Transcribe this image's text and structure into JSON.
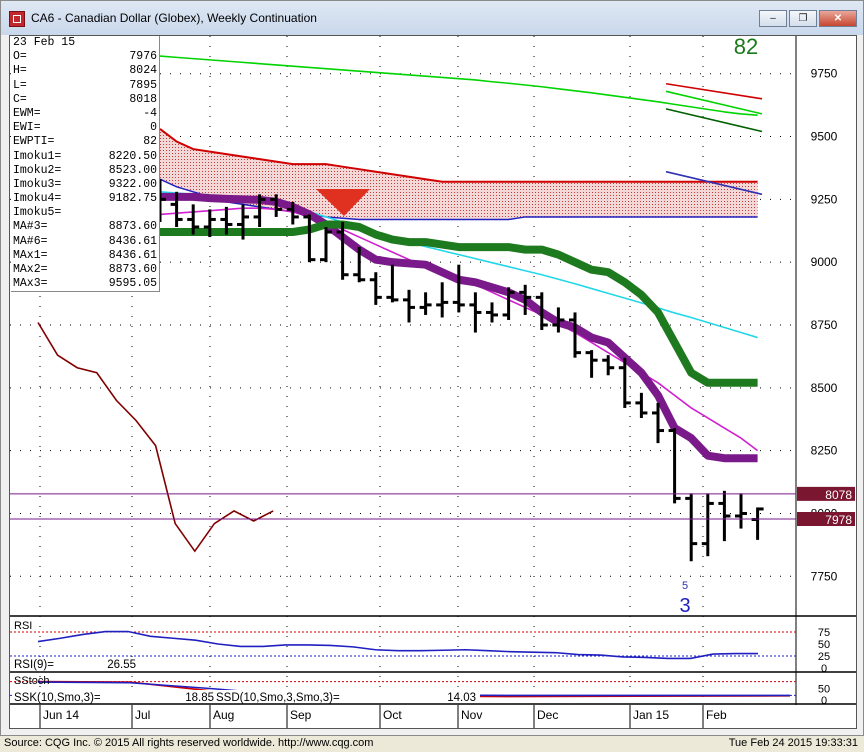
{
  "window": {
    "title": "CA6 - Canadian Dollar (Globex), Weekly Continuation",
    "buttons": {
      "minimize": "–",
      "restore": "❐",
      "close": "✕"
    }
  },
  "info_panel": {
    "date": "23 Feb 15",
    "rows": [
      {
        "label": "O=",
        "value": "7976"
      },
      {
        "label": "H=",
        "value": "8024"
      },
      {
        "label": "L=",
        "value": "7895"
      },
      {
        "label": "C=",
        "value": "8018"
      },
      {
        "label": "EWM=",
        "value": "-4"
      },
      {
        "label": "EWI=",
        "value": "0"
      },
      {
        "label": "EWPTI=",
        "value": "82"
      },
      {
        "label": "Imoku1=",
        "value": "8220.50"
      },
      {
        "label": "Imoku2=",
        "value": "8523.00"
      },
      {
        "label": "Imoku3=",
        "value": "9322.00"
      },
      {
        "label": "Imoku4=",
        "value": "9182.75"
      },
      {
        "label": "Imoku5=",
        "value": ""
      },
      {
        "label": "MA#3=",
        "value": "8873.60"
      },
      {
        "label": "MA#6=",
        "value": "8436.61"
      },
      {
        "label": "MAx1=",
        "value": "8436.61"
      },
      {
        "label": "MAx2=",
        "value": "8873.60"
      },
      {
        "label": "MAx3=",
        "value": "9595.05"
      }
    ]
  },
  "panels": {
    "rsi": {
      "title": "RSI",
      "readout_label": "RSI(9)=",
      "readout_value": "26.55",
      "ticks": [
        "75",
        "50",
        "25",
        "0"
      ]
    },
    "stoch": {
      "title": "SStoch",
      "ssk_label": "SSK(10,Smo,3)=",
      "ssk_value": "18.85",
      "ssd_label": "SSD(10,Smo,3,Smo,3)=",
      "ssd_value": "14.03",
      "ticks": [
        "50",
        "0"
      ]
    }
  },
  "chart_data": {
    "type": "bar",
    "subtype": "ohlc",
    "title": "CA6 - Canadian Dollar (Globex), Weekly Continuation",
    "ylim": [
      7600,
      9900
    ],
    "y_ticks": [
      9750,
      9500,
      9250,
      9000,
      8750,
      8500,
      8250,
      8000,
      7750
    ],
    "x_ticks": [
      "Jun 14",
      "Jul",
      "Aug",
      "Sep",
      "Oct",
      "Nov",
      "Dec",
      "Jan 15",
      "Feb"
    ],
    "grid": true,
    "ewpti_value": "82",
    "wave_labels": [
      "5",
      "3"
    ],
    "price_tags": [
      {
        "label": "8078",
        "value": 8078,
        "color": "#7a1630"
      },
      {
        "label": "7978",
        "value": 7978,
        "color": "#7a1630"
      }
    ],
    "bars": [
      {
        "o": 9270,
        "h": 9330,
        "l": 9160,
        "c": 9250
      },
      {
        "o": 9230,
        "h": 9280,
        "l": 9140,
        "c": 9170
      },
      {
        "o": 9170,
        "h": 9230,
        "l": 9110,
        "c": 9140
      },
      {
        "o": 9140,
        "h": 9210,
        "l": 9100,
        "c": 9170
      },
      {
        "o": 9170,
        "h": 9220,
        "l": 9110,
        "c": 9150
      },
      {
        "o": 9150,
        "h": 9230,
        "l": 9090,
        "c": 9180
      },
      {
        "o": 9180,
        "h": 9270,
        "l": 9140,
        "c": 9250
      },
      {
        "o": 9250,
        "h": 9270,
        "l": 9180,
        "c": 9210
      },
      {
        "o": 9210,
        "h": 9240,
        "l": 9150,
        "c": 9180
      },
      {
        "o": 9180,
        "h": 9190,
        "l": 9000,
        "c": 9010
      },
      {
        "o": 9010,
        "h": 9140,
        "l": 9000,
        "c": 9120
      },
      {
        "o": 9120,
        "h": 9160,
        "l": 8930,
        "c": 8950
      },
      {
        "o": 8950,
        "h": 9060,
        "l": 8920,
        "c": 8930
      },
      {
        "o": 8930,
        "h": 8960,
        "l": 8830,
        "c": 8860
      },
      {
        "o": 8860,
        "h": 8990,
        "l": 8840,
        "c": 8850
      },
      {
        "o": 8850,
        "h": 8890,
        "l": 8760,
        "c": 8820
      },
      {
        "o": 8820,
        "h": 8880,
        "l": 8790,
        "c": 8830
      },
      {
        "o": 8830,
        "h": 8920,
        "l": 8780,
        "c": 8840
      },
      {
        "o": 8840,
        "h": 8990,
        "l": 8800,
        "c": 8830
      },
      {
        "o": 8830,
        "h": 8880,
        "l": 8720,
        "c": 8800
      },
      {
        "o": 8800,
        "h": 8840,
        "l": 8760,
        "c": 8790
      },
      {
        "o": 8790,
        "h": 8900,
        "l": 8770,
        "c": 8880
      },
      {
        "o": 8880,
        "h": 8910,
        "l": 8790,
        "c": 8860
      },
      {
        "o": 8860,
        "h": 8880,
        "l": 8730,
        "c": 8750
      },
      {
        "o": 8750,
        "h": 8820,
        "l": 8720,
        "c": 8770
      },
      {
        "o": 8770,
        "h": 8800,
        "l": 8620,
        "c": 8640
      },
      {
        "o": 8640,
        "h": 8650,
        "l": 8540,
        "c": 8610
      },
      {
        "o": 8610,
        "h": 8630,
        "l": 8550,
        "c": 8580
      },
      {
        "o": 8580,
        "h": 8620,
        "l": 8420,
        "c": 8440
      },
      {
        "o": 8440,
        "h": 8480,
        "l": 8380,
        "c": 8400
      },
      {
        "o": 8400,
        "h": 8440,
        "l": 8280,
        "c": 8330
      },
      {
        "o": 8330,
        "h": 8340,
        "l": 8040,
        "c": 8060
      },
      {
        "o": 8060,
        "h": 8080,
        "l": 7810,
        "c": 7880
      },
      {
        "o": 7880,
        "h": 8080,
        "l": 7830,
        "c": 8040
      },
      {
        "o": 8040,
        "h": 8090,
        "l": 7890,
        "c": 7990
      },
      {
        "o": 7990,
        "h": 8080,
        "l": 7940,
        "c": 8000
      },
      {
        "o": 7976,
        "h": 8024,
        "l": 7895,
        "c": 8018
      }
    ],
    "series": [
      {
        "name": "MAx3",
        "color": "#00d400",
        "values": [
          9820,
          9815,
          9810,
          9805,
          9800,
          9795,
          9790,
          9785,
          9780,
          9775,
          9770,
          9765,
          9760,
          9755,
          9750,
          9745,
          9740,
          9735,
          9730,
          9725,
          9718,
          9712,
          9705,
          9698,
          9690,
          9682,
          9674,
          9665,
          9656,
          9647,
          9638,
          9628,
          9618,
          9608,
          9598,
          9590,
          9585
        ]
      },
      {
        "name": "MAx2",
        "color": "#22d8e8",
        "values": [
          9280,
          9275,
          9270,
          9262,
          9254,
          9246,
          9238,
          9228,
          9216,
          9200,
          9180,
          9160,
          9140,
          9120,
          9100,
          9080,
          9062,
          9046,
          9030,
          9014,
          8998,
          8982,
          8966,
          8950,
          8932,
          8914,
          8895,
          8876,
          8857,
          8838,
          8818,
          8798,
          8780,
          8760,
          8740,
          8720,
          8700
        ]
      },
      {
        "name": "MA#6",
        "color": "#d020d0",
        "values": [
          9190,
          9195,
          9200,
          9205,
          9210,
          9215,
          9215,
          9210,
          9200,
          9180,
          9160,
          9130,
          9100,
          9070,
          9040,
          9010,
          8985,
          8960,
          8935,
          8910,
          8880,
          8850,
          8820,
          8790,
          8755,
          8720,
          8680,
          8640,
          8600,
          8560,
          8520,
          8470,
          8420,
          8380,
          8340,
          8300,
          8250
        ]
      },
      {
        "name": "MA#3 (thick)",
        "color": "#7a1a8a",
        "values": [
          9260,
          9260,
          9260,
          9255,
          9252,
          9250,
          9248,
          9240,
          9220,
          9190,
          9150,
          9100,
          9050,
          9010,
          9000,
          8995,
          8990,
          8960,
          8930,
          8920,
          8900,
          8880,
          8850,
          8800,
          8760,
          8740,
          8700,
          8680,
          8620,
          8560,
          8470,
          8340,
          8300,
          8230,
          8220,
          8220,
          8220
        ]
      },
      {
        "name": "Imoku Base (thick)",
        "color": "#1e7a1e",
        "values": [
          9120,
          9120,
          9120,
          9120,
          9120,
          9120,
          9120,
          9120,
          9120,
          9130,
          9150,
          9150,
          9140,
          9110,
          9090,
          9080,
          9080,
          9070,
          9060,
          9060,
          9060,
          9060,
          9050,
          9050,
          9030,
          9000,
          8970,
          8960,
          8920,
          8870,
          8800,
          8680,
          8560,
          8520,
          8520,
          8520,
          8520
        ]
      }
    ],
    "cloud": {
      "upper": [
        9530,
        9480,
        9450,
        9440,
        9430,
        9420,
        9410,
        9400,
        9390,
        9390,
        9390,
        9380,
        9370,
        9360,
        9350,
        9340,
        9330,
        9320,
        9320,
        9320,
        9320,
        9320,
        9320,
        9320,
        9320,
        9320,
        9320,
        9320,
        9320,
        9320,
        9320,
        9320,
        9320,
        9320,
        9320,
        9320,
        9320
      ],
      "lower": [
        9330,
        9300,
        9280,
        9260,
        9240,
        9230,
        9220,
        9210,
        9200,
        9190,
        9180,
        9175,
        9170,
        9170,
        9170,
        9170,
        9170,
        9170,
        9170,
        9170,
        9170,
        9170,
        9180,
        9180,
        9180,
        9180,
        9180,
        9180,
        9180,
        9180,
        9180,
        9180,
        9180,
        9180,
        9180,
        9180,
        9180
      ]
    },
    "projection_lines": [
      {
        "name": "red",
        "color": "#d00000",
        "from": 9710,
        "to": 9650
      },
      {
        "name": "green",
        "color": "#00d400",
        "from": 9680,
        "to": 9590
      },
      {
        "name": "darkgreen",
        "color": "#006000",
        "from": 9610,
        "to": 9520
      },
      {
        "name": "blue",
        "color": "#3030b0",
        "from": 9360,
        "to": 9270
      }
    ],
    "lower_oscillator": [
      8760,
      8630,
      8580,
      8560,
      8450,
      8370,
      8270,
      7960,
      7850,
      7960,
      8010,
      7970,
      8010
    ]
  }
}
